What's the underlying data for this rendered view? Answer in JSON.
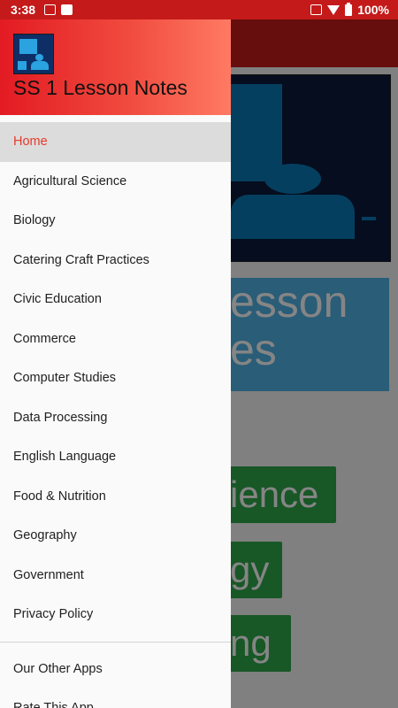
{
  "status_bar": {
    "time": "3:38",
    "battery": "100%"
  },
  "background": {
    "banner_line1": "esson",
    "banner_line2": "es",
    "pill1": "ience",
    "pill2": "gy",
    "pill3": "ng"
  },
  "drawer": {
    "title": "SS 1 Lesson Notes",
    "items": [
      {
        "label": "Home",
        "active": true
      },
      {
        "label": "Agricultural Science"
      },
      {
        "label": "Biology"
      },
      {
        "label": "Catering Craft Practices"
      },
      {
        "label": "Civic Education"
      },
      {
        "label": "Commerce"
      },
      {
        "label": "Computer Studies"
      },
      {
        "label": "Data Processing"
      },
      {
        "label": "English Language"
      },
      {
        "label": "Food & Nutrition"
      },
      {
        "label": "Geography"
      },
      {
        "label": "Government"
      },
      {
        "label": "Privacy Policy"
      }
    ],
    "secondary_items": [
      {
        "label": "Our Other Apps"
      },
      {
        "label": "Rate This App"
      }
    ]
  },
  "colors": {
    "accent": "#e53a2b",
    "toolbar": "#c41a1a"
  }
}
